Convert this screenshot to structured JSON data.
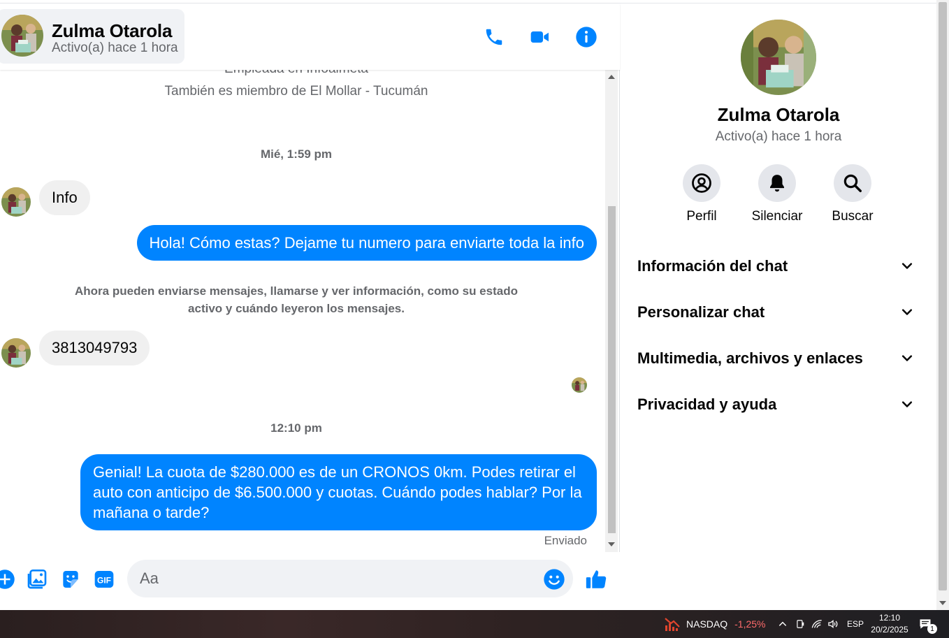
{
  "header": {
    "name": "Zulma Otarola",
    "status": "Activo(a) hace 1 hora"
  },
  "conversation": {
    "partial_line": "Empleada en Infoalmeta",
    "member_note": "También es miembro de El Mollar - Tucumán",
    "time_1": "Mié, 1:59 pm",
    "msg_in_1": "Info",
    "msg_out_1": "Hola! Cómo estas? Dejame tu numero para enviarte toda la info",
    "notice_line_1": "Ahora pueden enviarse mensajes, llamarse y ver información, como su estado",
    "notice_line_2": "activo y cuándo leyeron los mensajes.",
    "msg_in_2": "3813049793",
    "time_2": "12:10 pm",
    "msg_out_2_line_1": "Genial! La cuota de $280.000 es de un CRONOS 0km. Podes retirar el",
    "msg_out_2_line_2": "auto con anticipo de $6.500.000 y cuotas. Cuándo podes hablar? Por la",
    "msg_out_2_line_3": "mañana o tarde?",
    "sent_status": "Enviado"
  },
  "composer": {
    "placeholder": "Aa"
  },
  "info": {
    "name": "Zulma Otarola",
    "status": "Activo(a) hace 1 hora",
    "actions": [
      {
        "label": "Perfil",
        "icon": "profile-icon"
      },
      {
        "label": "Silenciar",
        "icon": "bell-icon"
      },
      {
        "label": "Buscar",
        "icon": "search-icon"
      }
    ],
    "sections": [
      {
        "label": "Información del chat"
      },
      {
        "label": "Personalizar chat"
      },
      {
        "label": "Multimedia, archivos y enlaces"
      },
      {
        "label": "Privacidad y ayuda"
      }
    ]
  },
  "taskbar": {
    "ticker_name": "NASDAQ",
    "ticker_change": "-1,25%",
    "lang": "ESP",
    "time": "12:10",
    "date": "20/2/2025",
    "notification_count": "1"
  },
  "colors": {
    "accent": "#0084ff",
    "incoming_bubble": "#f0f0f0",
    "secondary_text": "#65676b",
    "ticker_negative": "#ff6b6b"
  }
}
